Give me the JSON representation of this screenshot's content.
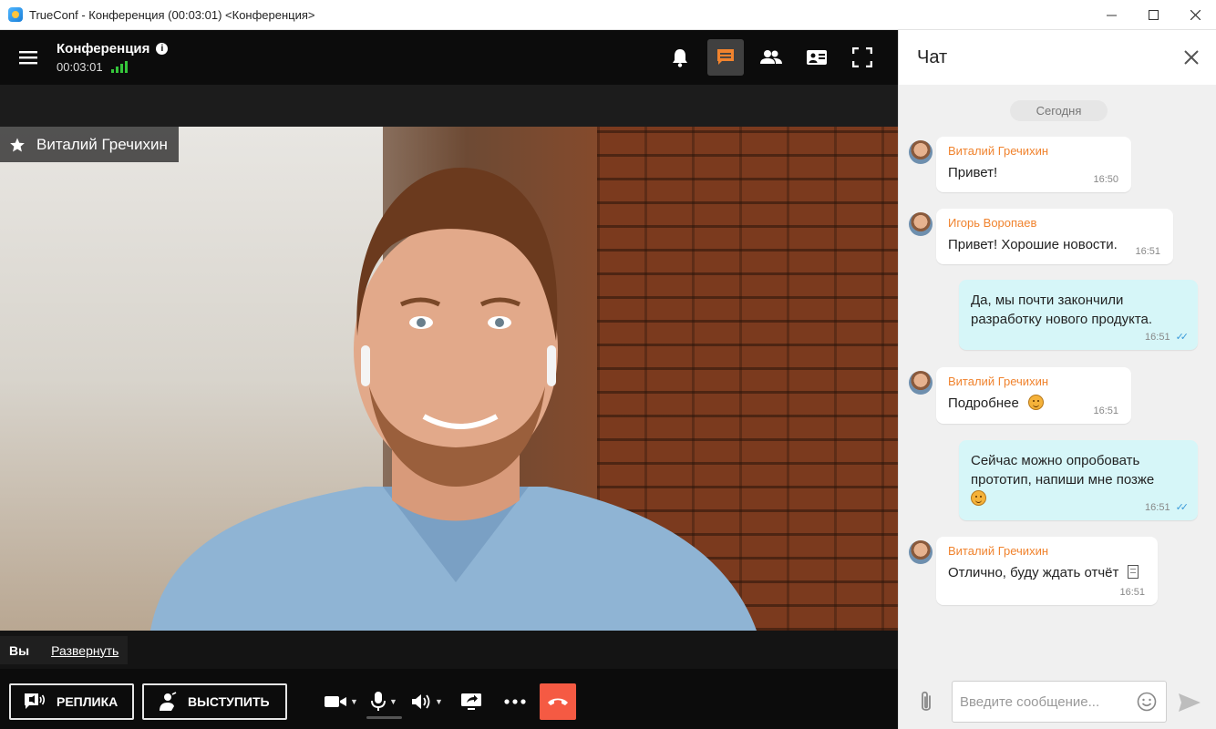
{
  "window": {
    "title": "TrueConf - Конференция (00:03:01) <Конференция>",
    "controls": {
      "minimize": "—",
      "maximize": "☐",
      "close": "✕"
    }
  },
  "conference": {
    "name": "Конференция",
    "info_icon": "i",
    "timer": "00:03:01",
    "signal_bars": 4,
    "signal_color": "#35c53b",
    "top_actions": [
      "bell-icon",
      "chat-icon",
      "participants-icon",
      "content-share-icon",
      "fullscreen-icon"
    ],
    "active_action": "chat-icon",
    "accent": "#f0832e"
  },
  "video": {
    "speaker_name": "Виталий Гречихин"
  },
  "self_view": {
    "you_label": "Вы",
    "expand_link": "Развернуть"
  },
  "controls": {
    "replica_label": "РЕПЛИКА",
    "speak_label": "ВЫСТУПИТЬ",
    "hangup_color": "#f55a43"
  },
  "chat": {
    "title": "Чат",
    "date_separator": "Сегодня",
    "messages": [
      {
        "sender": "Виталий Гречихин",
        "text": "Привет!",
        "time": "16:50",
        "mine": false
      },
      {
        "sender": "Игорь Воропаев",
        "text": "Привет! Хорошие новости.",
        "time": "16:51",
        "mine": false
      },
      {
        "sender": "",
        "line1": "Да, мы почти закончили",
        "line2": "разработку нового продукта.",
        "time": "16:51",
        "mine": true
      },
      {
        "sender": "Виталий Гречихин",
        "text": "Подробнее",
        "time": "16:51",
        "mine": false
      },
      {
        "sender": "",
        "line1": "Сейчас можно опробовать",
        "line2": "прототип, напиши мне позже",
        "time": "16:51",
        "mine": true
      },
      {
        "sender": "Виталий Гречихин",
        "text": "Отлично, буду ждать отчёт",
        "time": "16:51",
        "mine": false
      }
    ],
    "input_placeholder": "Введите сообщение..."
  }
}
